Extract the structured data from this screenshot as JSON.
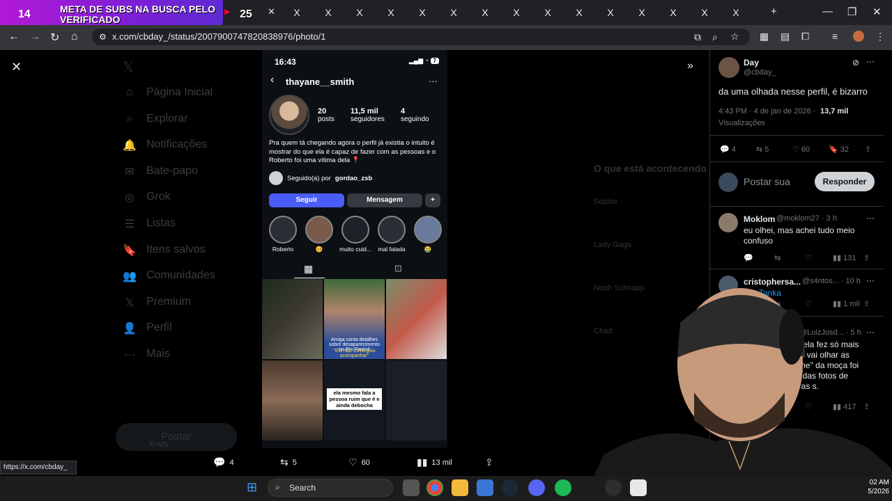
{
  "overlay": {
    "sub_count": "14",
    "sub_goal_text": "META DE SUBS NA BUSCA PELO VERIFICADO",
    "sub_count_2": "25"
  },
  "browser": {
    "url": "x.com/cbday_/status/2007900747820838976/photo/1",
    "tabs": [
      "X",
      "X",
      "X",
      "X",
      "X",
      "X",
      "X",
      "X",
      "X",
      "X",
      "X",
      "X",
      "X",
      "X",
      "X"
    ],
    "status_url": "https://x.com/cbday_"
  },
  "x_sidebar": {
    "items": [
      "Página Inicial",
      "Explorar",
      "Notificações",
      "Bate-papo",
      "Grok",
      "Listas",
      "Itens salvos",
      "Comunidades",
      "Premium",
      "Perfil",
      "Mais"
    ],
    "post_button": "Postar",
    "account": "Krazy"
  },
  "instagram": {
    "time": "16:43",
    "battery": "7",
    "username": "thayane__smith",
    "posts": "20",
    "posts_label": "posts",
    "followers": "11,5 mil",
    "followers_label": "seguidores",
    "following": "4",
    "following_label": "seguindo",
    "bio": "Pra quem tá chegando agora o perfil já existia o intuito é mostrar do que ela é capaz de fazer com as pessoas e o Roberto foi uma vítima dela 📍",
    "followed_by_prefix": "Seguido(a) por",
    "followed_by": "gordao_zsb",
    "follow_btn": "Seguir",
    "message_btn": "Mensagem",
    "stories": [
      "Roberto",
      "🤒",
      "muito cuid...",
      "mal falada",
      "🤮"
    ],
    "post_caption_1": "Amiga conta detalhes sobre desaparecimento no Rio Paraná",
    "post_caption_2": "\"Ela não conseguiu acompanhar\"",
    "post_caption_3": "ela mesmo fala a pessoa ruim que é e ainda debocha"
  },
  "action_bar": {
    "replies": "4",
    "reposts": "5",
    "likes": "60",
    "views": "13 mil"
  },
  "tweet": {
    "author": "Day",
    "handle": "@cbday_",
    "text": "da uma olhada nesse perfil, é bizarro",
    "datetime": "4:43 PM · 4 de jan de 2026 ·",
    "views": "13,7 mil",
    "views_label": "Visualizações",
    "replies": "4",
    "reposts": "5",
    "likes": "60",
    "bookmarks": "32",
    "reply_placeholder": "Postar sua",
    "reply_button": "Responder"
  },
  "replies": [
    {
      "name": "Moklom",
      "handle": "@moklom27 · 3 h",
      "text": "eu olhei, mas achei tudo meio confuso",
      "views": "131"
    },
    {
      "name": "cristophersa...",
      "handle": "@s4ntos... · 10 h",
      "text": "Tanka",
      "views": "1 mil"
    },
    {
      "name": "",
      "handle": "@LuizJosd... · 5 h",
      "text": "que ela fez só mais você vai olhar as \"crime\" da moça foi ose das fotos de outras s.",
      "views": "417"
    }
  ],
  "bg_trends": {
    "header": "O que está acontecendo",
    "items": [
      "Sophie",
      "Lady Gaga",
      "Noah Schnapp",
      "Chad"
    ]
  },
  "taskbar": {
    "search": "Search",
    "time": "02 AM",
    "date": "5/2026"
  }
}
